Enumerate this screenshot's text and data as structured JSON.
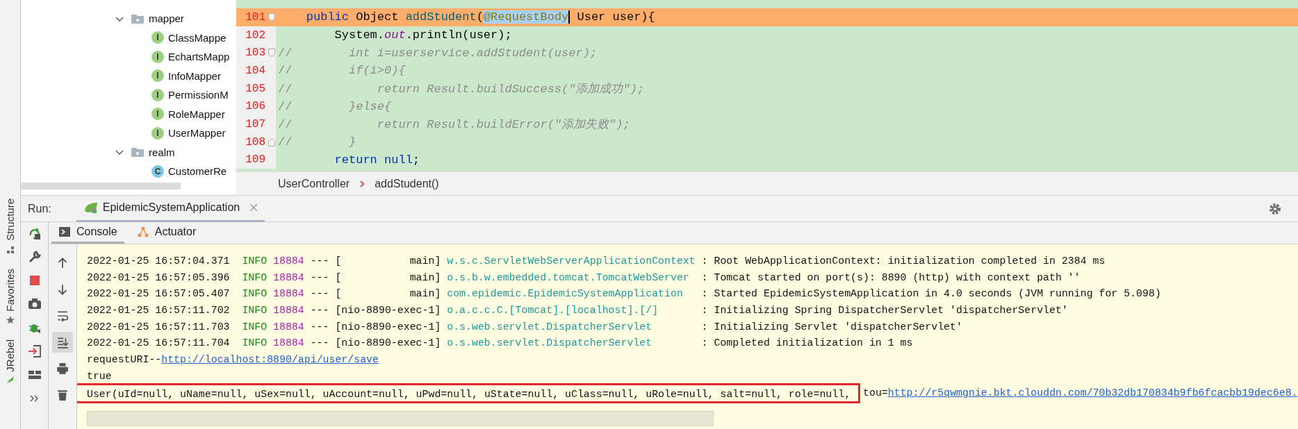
{
  "tool_windows": [
    {
      "label": "Structure",
      "kind": "structure"
    },
    {
      "label": "Favorites",
      "kind": "favorites"
    },
    {
      "label": "JRebel",
      "kind": "jrebel"
    }
  ],
  "tree": {
    "items": [
      {
        "label": "mapper",
        "kind": "folder",
        "expanded": true,
        "selected": false,
        "children": [
          {
            "label": "ClassMappe",
            "kind": "file",
            "badge": "I",
            "selected": false
          },
          {
            "label": "EchartsMapp",
            "kind": "file",
            "badge": "I",
            "selected": false
          },
          {
            "label": "InfoMapper",
            "kind": "file",
            "badge": "I",
            "selected": false
          },
          {
            "label": "PermissionM",
            "kind": "file",
            "badge": "I",
            "selected": false
          },
          {
            "label": "RoleMapper",
            "kind": "file",
            "badge": "I",
            "selected": false
          },
          {
            "label": "UserMapper",
            "kind": "file",
            "badge": "I",
            "selected": false
          }
        ]
      },
      {
        "label": "realm",
        "kind": "folder",
        "expanded": true,
        "selected": false,
        "children": [
          {
            "label": "CustomerRe",
            "kind": "file",
            "badge": "C",
            "selected": false
          }
        ]
      }
    ]
  },
  "code": {
    "lines": [
      {
        "number": "101",
        "highlighted": true,
        "kind": "fold-start",
        "tokens": [
          {
            "text": "    public",
            "kind": "keyword"
          },
          {
            "text": " Object ",
            "kind": "plain"
          },
          {
            "text": "addStudent",
            "kind": "method"
          },
          {
            "text": "(",
            "kind": "plain"
          },
          {
            "text": "@RequestBody",
            "kind": "selection"
          },
          {
            "text": " User user){",
            "kind": "plain"
          }
        ]
      },
      {
        "number": "102",
        "highlighted": false,
        "kind": "code",
        "tokens": [
          {
            "text": "        System.",
            "kind": "plain"
          },
          {
            "text": "out",
            "kind": "static"
          },
          {
            "text": ".println(user);",
            "kind": "plain"
          }
        ]
      },
      {
        "number": "103",
        "highlighted": false,
        "kind": "fold-start",
        "tokens": [
          {
            "text": "//",
            "kind": "comment-mark"
          },
          {
            "text": "        int i=userservice.addStudent(user);",
            "kind": "comment"
          }
        ]
      },
      {
        "number": "104",
        "highlighted": false,
        "kind": "code",
        "tokens": [
          {
            "text": "//",
            "kind": "comment-mark"
          },
          {
            "text": "        if(i>0){",
            "kind": "comment"
          }
        ]
      },
      {
        "number": "105",
        "highlighted": false,
        "kind": "code",
        "tokens": [
          {
            "text": "//",
            "kind": "comment-mark"
          },
          {
            "text": "            return Result.buildSuccess(\"添加成功\");",
            "kind": "comment"
          }
        ]
      },
      {
        "number": "106",
        "highlighted": false,
        "kind": "code",
        "tokens": [
          {
            "text": "//",
            "kind": "comment-mark"
          },
          {
            "text": "        }else{",
            "kind": "comment"
          }
        ]
      },
      {
        "number": "107",
        "highlighted": false,
        "kind": "code",
        "tokens": [
          {
            "text": "//",
            "kind": "comment-mark"
          },
          {
            "text": "            return Result.buildError(\"添加失败\");",
            "kind": "comment"
          }
        ]
      },
      {
        "number": "108",
        "highlighted": false,
        "kind": "fold-end",
        "tokens": [
          {
            "text": "//",
            "kind": "comment-mark"
          },
          {
            "text": "        }",
            "kind": "comment"
          }
        ]
      },
      {
        "number": "109",
        "highlighted": false,
        "kind": "code",
        "tokens": [
          {
            "text": "        return",
            "kind": "keyword"
          },
          {
            "text": " null",
            "kind": "keyword"
          },
          {
            "text": ";",
            "kind": "plain"
          }
        ]
      }
    ]
  },
  "breadcrumb": [
    "UserController",
    "addStudent()"
  ],
  "run": {
    "label": "Run:",
    "tabs": [
      {
        "label": "EpidemicSystemApplication",
        "selected": true
      }
    ]
  },
  "console_tabs": [
    {
      "label": "Console",
      "kind": "console",
      "selected": true
    },
    {
      "label": "Actuator",
      "kind": "actuator",
      "selected": false
    }
  ],
  "console_tools": [
    {
      "kind": "up",
      "selected": false
    },
    {
      "kind": "down",
      "selected": false
    },
    {
      "kind": "wrap",
      "selected": false
    },
    {
      "kind": "scroll-end",
      "selected": true
    },
    {
      "kind": "print",
      "selected": false
    },
    {
      "kind": "trash",
      "selected": false
    }
  ],
  "console": [
    {
      "kind": "log",
      "time": "2022-01-25 16:57:04.371",
      "level": "INFO",
      "pid": "18884",
      "sep": "---",
      "thread": "[           main]",
      "logger": "w.s.c.ServletWebServerApplicationContext",
      "message": ": Root WebApplicationContext: initialization completed in 2384 ms"
    },
    {
      "kind": "log",
      "time": "2022-01-25 16:57:05.396",
      "level": "INFO",
      "pid": "18884",
      "sep": "---",
      "thread": "[           main]",
      "logger": "o.s.b.w.embedded.tomcat.TomcatWebServer",
      "message": ": Tomcat started on port(s): 8890 (http) with context path ''"
    },
    {
      "kind": "log",
      "time": "2022-01-25 16:57:05.407",
      "level": "INFO",
      "pid": "18884",
      "sep": "---",
      "thread": "[           main]",
      "logger": "com.epidemic.EpidemicSystemApplication",
      "message": ": Started EpidemicSystemApplication in 4.0 seconds (JVM running for 5.098)"
    },
    {
      "kind": "log",
      "time": "2022-01-25 16:57:11.702",
      "level": "INFO",
      "pid": "18884",
      "sep": "---",
      "thread": "[nio-8890-exec-1]",
      "logger": "o.a.c.c.C.[Tomcat].[localhost].[/]",
      "message": ": Initializing Spring DispatcherServlet 'dispatcherServlet'"
    },
    {
      "kind": "log",
      "time": "2022-01-25 16:57:11.703",
      "level": "INFO",
      "pid": "18884",
      "sep": "---",
      "thread": "[nio-8890-exec-1]",
      "logger": "o.s.web.servlet.DispatcherServlet",
      "message": ": Initializing Servlet 'dispatcherServlet'"
    },
    {
      "kind": "log",
      "time": "2022-01-25 16:57:11.704",
      "level": "INFO",
      "pid": "18884",
      "sep": "---",
      "thread": "[nio-8890-exec-1]",
      "logger": "o.s.web.servlet.DispatcherServlet",
      "message": ": Completed initialization in 1 ms"
    },
    {
      "kind": "output",
      "segments": [
        {
          "text": "requestURI--",
          "kind": "plain",
          "framed": false
        },
        {
          "text": "http://localhost:8890/api/user/save",
          "kind": "link",
          "framed": false
        }
      ]
    },
    {
      "kind": "output",
      "segments": [
        {
          "text": "true",
          "kind": "plain",
          "framed": false
        }
      ]
    },
    {
      "kind": "output",
      "segments": [
        {
          "text": "User(uId=null, uName=null, uSex=null, uAccount=null, uPwd=null, uState=null, uClass=null, uRole=null, salt=null, role=null, ",
          "kind": "plain",
          "framed": true
        },
        {
          "text": "tou=",
          "kind": "plain",
          "framed": false
        },
        {
          "text": "http://r5qwmgnie.bkt.clouddn.com/70b32db170834b9fb6fcacbb19dec6e8.",
          "kind": "link",
          "framed": false
        }
      ]
    }
  ]
}
